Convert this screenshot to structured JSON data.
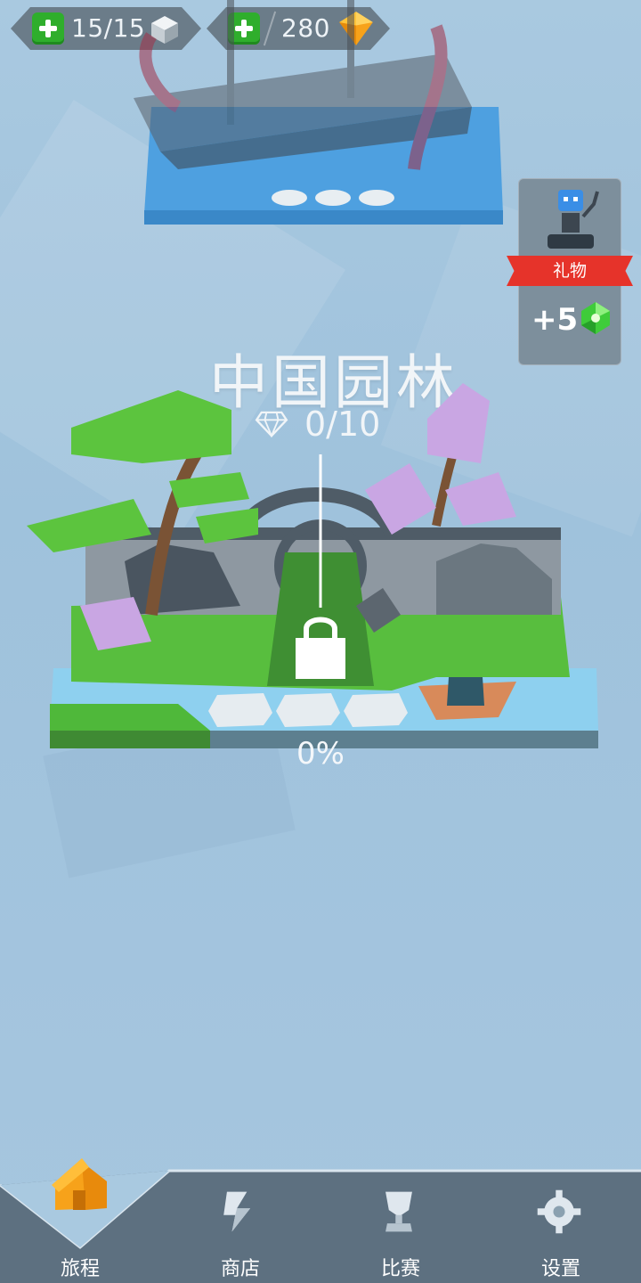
{
  "resources": {
    "lives": {
      "value": "15/15",
      "icon": "cube-icon"
    },
    "gems": {
      "value": "280",
      "icon": "orange-gem-icon"
    }
  },
  "gift": {
    "label": "礼物",
    "reward": "+5",
    "icon": "green-gem-icon"
  },
  "level": {
    "title": "中国园林",
    "gems_collected": "0/10",
    "progress": "0%",
    "locked": true
  },
  "nav": {
    "items": [
      {
        "label": "旅程",
        "icon": "house-icon",
        "active": true
      },
      {
        "label": "商店",
        "icon": "shop-icon",
        "active": false
      },
      {
        "label": "比赛",
        "icon": "trophy-icon",
        "active": false
      },
      {
        "label": "设置",
        "icon": "gear-icon",
        "active": false
      }
    ]
  },
  "colors": {
    "background": "#a9c9e0",
    "pill": "#6b7c89",
    "plus": "#2fae2c",
    "ribbon": "#e6332a",
    "nav": "#5d7080"
  }
}
